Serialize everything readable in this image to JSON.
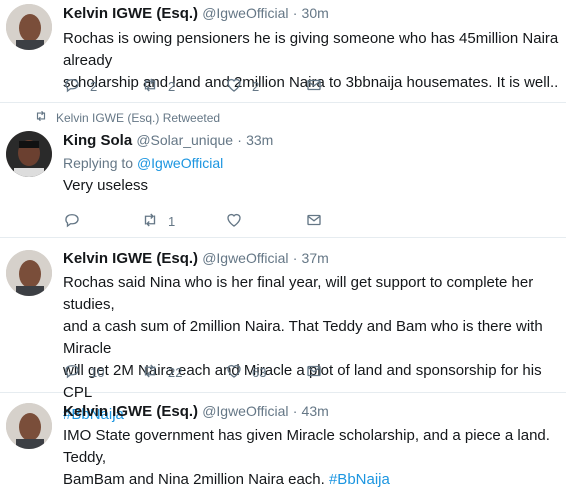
{
  "tweets": [
    {
      "name": "Kelvin IGWE (Esq.)",
      "handle": "@IgweOfficial",
      "time": "30m",
      "text": "Rochas is owing pensioners he is giving someone who has 45million Naira already\nscholarship and land and 2million Naira to 3bbnaija housemates. It is well..",
      "replies": "2",
      "retweets": "2",
      "likes": "2"
    },
    {
      "retweeted_by": "Kelvin IGWE (Esq.) Retweeted",
      "name": "King Sola",
      "handle": "@Solar_unique",
      "time": "33m",
      "replying_prefix": "Replying to ",
      "replying_to": "@IgweOfficial",
      "text": "Very useless",
      "replies": "",
      "retweets": "1",
      "likes": ""
    },
    {
      "name": "Kelvin IGWE (Esq.)",
      "handle": "@IgweOfficial",
      "time": "37m",
      "text": "Rochas said Nina who is her final year, will get support to complete her studies,\nand a cash sum of 2million Naira. That Teddy and Bam who is there with Miracle\nwill get 2M Naira each and Miracle a plot of land and sponsorship for his CPL",
      "hashtag": "#BbNaija",
      "replies": "10",
      "retweets": "22",
      "likes": "63"
    },
    {
      "name": "Kelvin IGWE (Esq.)",
      "handle": "@IgweOfficial",
      "time": "43m",
      "text": "IMO State government has given Miracle scholarship, and a piece a land. Teddy,\nBamBam and Nina 2million Naira each. ",
      "hashtag": "#BbNaija"
    }
  ],
  "separator": "·",
  "icons": {
    "reply": "reply-icon",
    "retweet": "retweet-icon",
    "like": "heart-icon",
    "dm": "envelope-icon"
  },
  "colors": {
    "link": "#1b95e0",
    "muted": "#657786",
    "text": "#14171a",
    "border": "#e6ecf0"
  }
}
